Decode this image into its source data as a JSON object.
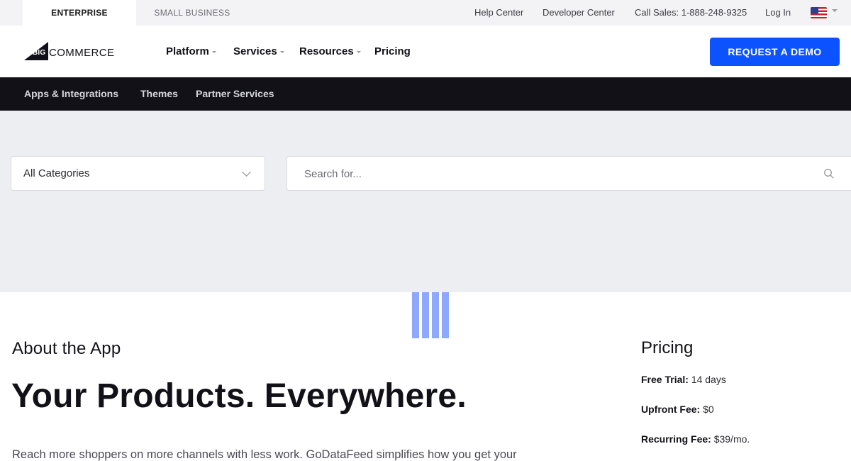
{
  "topbar": {
    "segments": {
      "active": "ENTERPRISE",
      "inactive": "SMALL BUSINESS"
    },
    "links": {
      "help": "Help Center",
      "developer": "Developer Center",
      "sales": "Call Sales: 1-888-248-9325",
      "login": "Log In"
    },
    "flag_icon": "us-flag-icon"
  },
  "header": {
    "logo": {
      "big": "BIG",
      "commerce": "COMMERCE"
    },
    "nav": {
      "platform": "Platform",
      "services": "Services",
      "resources": "Resources",
      "pricing": "Pricing"
    },
    "cta": "REQUEST A DEMO",
    "accent_color": "#0d52ff"
  },
  "subnav": {
    "apps": "Apps & Integrations",
    "themes": "Themes",
    "partners": "Partner Services"
  },
  "search": {
    "category_value": "All Categories",
    "placeholder": "Search for..."
  },
  "content": {
    "about_heading": "About the App",
    "hero_title": "Your Products. Everywhere.",
    "description": "Reach more shoppers on more channels with less work. GoDataFeed simplifies how you get your"
  },
  "pricing": {
    "heading": "Pricing",
    "free_trial_label": "Free Trial:",
    "free_trial_value": "14 days",
    "upfront_label": "Upfront Fee:",
    "upfront_value": "$0",
    "recurring_label": "Recurring Fee:",
    "recurring_value": "$39/mo."
  }
}
